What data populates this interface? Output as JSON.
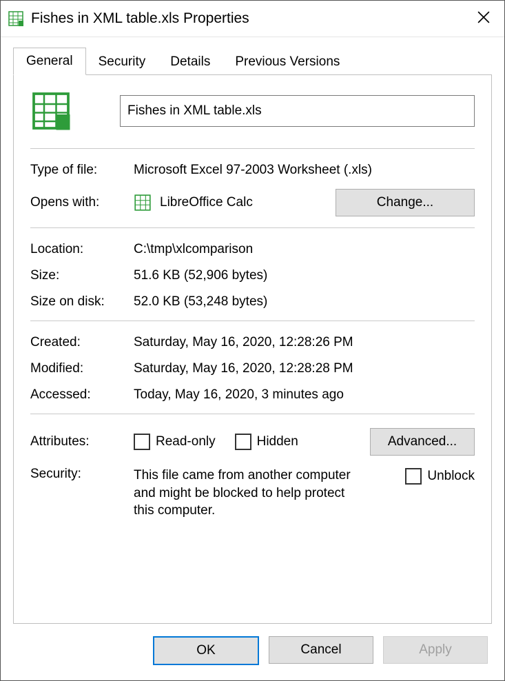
{
  "window": {
    "title": "Fishes in XML table.xls Properties"
  },
  "tabs": {
    "items": [
      "General",
      "Security",
      "Details",
      "Previous Versions"
    ],
    "activeIndex": 0
  },
  "general": {
    "filename": "Fishes in XML table.xls",
    "labels": {
      "type_of_file": "Type of file:",
      "opens_with": "Opens with:",
      "location": "Location:",
      "size": "Size:",
      "size_on_disk": "Size on disk:",
      "created": "Created:",
      "modified": "Modified:",
      "accessed": "Accessed:",
      "attributes": "Attributes:",
      "security": "Security:"
    },
    "type_of_file": "Microsoft Excel 97-2003 Worksheet (.xls)",
    "opens_with_app": "LibreOffice Calc",
    "change_button": "Change...",
    "location": "C:\\tmp\\xlcomparison",
    "size": "51.6 KB (52,906 bytes)",
    "size_on_disk": "52.0 KB (53,248 bytes)",
    "created": "Saturday, May 16, 2020, 12:28:26 PM",
    "modified": "Saturday, May 16, 2020, 12:28:28 PM",
    "accessed": "Today, May 16, 2020, 3 minutes ago",
    "attr_readonly": "Read-only",
    "attr_hidden": "Hidden",
    "advanced_button": "Advanced...",
    "security_text": "This file came from another computer and might be blocked to help protect this computer.",
    "unblock": "Unblock"
  },
  "footer": {
    "ok": "OK",
    "cancel": "Cancel",
    "apply": "Apply"
  }
}
